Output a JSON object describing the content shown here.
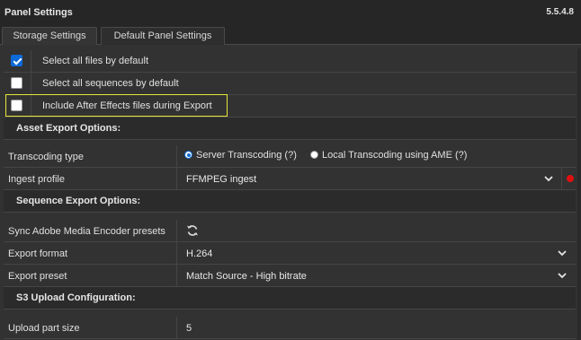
{
  "window": {
    "title": "Panel Settings",
    "version": "5.5.4.8"
  },
  "tabs": [
    {
      "label": "Storage Settings"
    },
    {
      "label": "Default Panel Settings"
    }
  ],
  "checkboxes": [
    {
      "label": "Select all files by default",
      "checked": true
    },
    {
      "label": "Select all sequences by default",
      "checked": false
    },
    {
      "label": "Include After Effects files during Export",
      "checked": false
    }
  ],
  "sections": {
    "asset": "Asset Export Options:",
    "sequence": "Sequence Export Options:",
    "s3": "S3 Upload Configuration:"
  },
  "asset": {
    "transcoding_label": "Transcoding type",
    "server_option": "Server Transcoding (?)",
    "local_option": "Local Transcoding using AME (?)",
    "selected": "server",
    "ingest_label": "Ingest profile",
    "ingest_value": "FFMPEG ingest"
  },
  "sequence": {
    "sync_label": "Sync Adobe Media Encoder presets",
    "format_label": "Export format",
    "format_value": "H.264",
    "preset_label": "Export preset",
    "preset_value": "Match Source - High bitrate"
  },
  "s3": {
    "part_size_label": "Upload part size",
    "part_size_value": "5"
  },
  "colors": {
    "accent": "#0d6ad8",
    "highlight": "#e6e63a",
    "status": "#e01010"
  }
}
